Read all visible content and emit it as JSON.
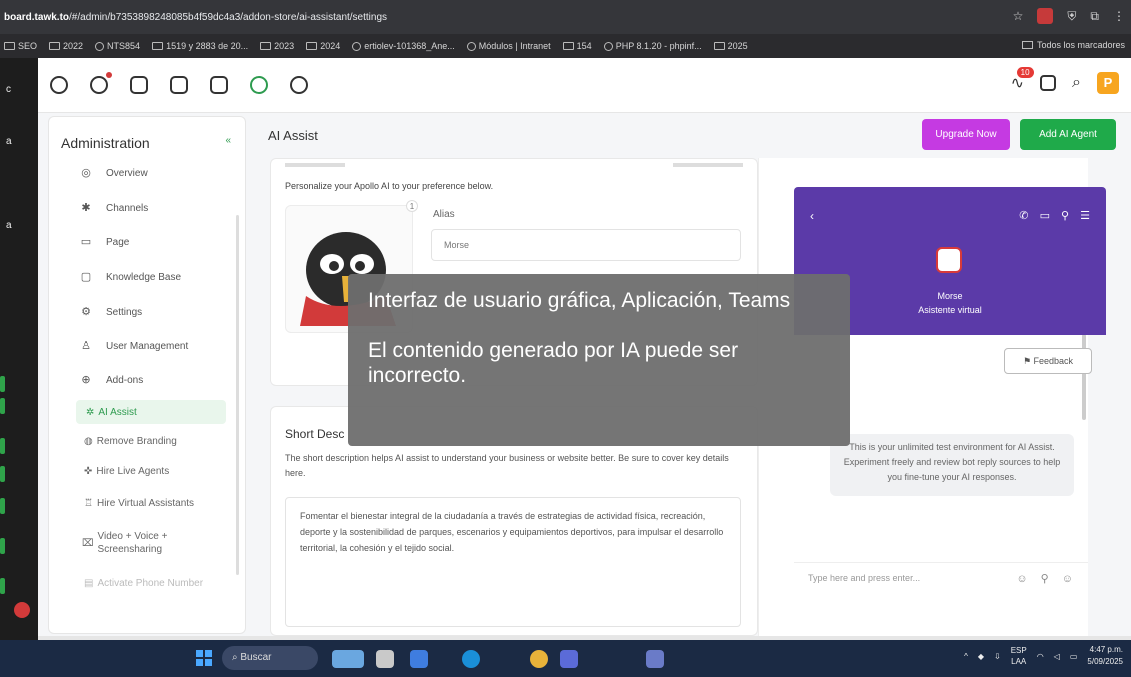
{
  "browser": {
    "url_host": "board.tawk.to",
    "url_path": "/#/admin/b7353898248085b4f59dc4a3/addon-store/ai-assistant/settings",
    "bookmarks": [
      "SEO",
      "2022",
      "NTS854",
      "1519 y 2883 de 20...",
      "2023",
      "2024",
      "ertiolev-101368_Ane...",
      "Módulos | Intranet",
      "154",
      "PHP 8.1.20 - phpinf...",
      "2025"
    ],
    "bookmarks_all": "Todos los marcadores"
  },
  "topnav": {
    "notification_count": "10",
    "profile_initial": "P"
  },
  "sidebar": {
    "title": "Administration",
    "collapse": "«",
    "items": [
      {
        "icon": "◎",
        "label": "Overview"
      },
      {
        "icon": "✱",
        "label": "Channels"
      },
      {
        "icon": "▭",
        "label": "Page"
      },
      {
        "icon": "▢",
        "label": "Knowledge Base"
      },
      {
        "icon": "⚙",
        "label": "Settings"
      },
      {
        "icon": "♙",
        "label": "User Management"
      },
      {
        "icon": "⊕",
        "label": "Add-ons"
      }
    ],
    "subitems": [
      {
        "icon": "✲",
        "label": "AI Assist"
      },
      {
        "icon": "◍",
        "label": "Remove Branding"
      },
      {
        "icon": "✜",
        "label": "Hire Live Agents"
      },
      {
        "icon": "♖",
        "label": "Hire Virtual Assistants"
      },
      {
        "icon": "⌧",
        "label": "Video + Voice + Screensharing"
      },
      {
        "icon": "▤",
        "label": "Activate Phone Number"
      }
    ]
  },
  "main": {
    "title": "AI Assist",
    "upgrade_label": "Upgrade Now",
    "add_agent_label": "Add AI Agent",
    "persona": {
      "description": "Personalize your Apollo AI to your preference below.",
      "avatar_number": "1",
      "alias_label": "Alias",
      "alias_value": "Morse"
    },
    "short_desc": {
      "title": "Short Desc",
      "help": "The short description helps AI assist to understand your business or website better. Be sure to cover key details here.",
      "value": "Fomentar el bienestar integral de la ciudadanía a través de estrategias de actividad física, recreación, deporte y la sostenibilidad de parques, escenarios y equipamientos deportivos, para impulsar el desarrollo territorial, la cohesión y el tejido social."
    }
  },
  "chat_preview": {
    "back": "‹",
    "actions": "✆ ▭ ⚲ ☰",
    "agent_name": "Morse",
    "agent_role": "Asistente virtual",
    "feedback_label": "⚑ Feedback",
    "bot_message": "This is your unlimited test environment for AI Assist. Experiment freely and review bot reply sources to help you fine-tune your AI responses.",
    "input_placeholder": "Type here and press enter...",
    "input_actions": "☺ ⚲ ☺"
  },
  "overlay": {
    "line1": "Interfaz de usuario gráfica, Aplicación, Teams",
    "line2": "El contenido generado por IA puede ser incorrecto."
  },
  "taskbar": {
    "search": "Buscar",
    "lang_top": "ESP",
    "lang_bottom": "LAA",
    "time": "4:47 p.m.",
    "date": "5/09/2025"
  },
  "colors": {
    "accent_green": "#1faa4a",
    "upgrade_purple": "#c53ae2",
    "chat_header": "#5b3aa8"
  }
}
